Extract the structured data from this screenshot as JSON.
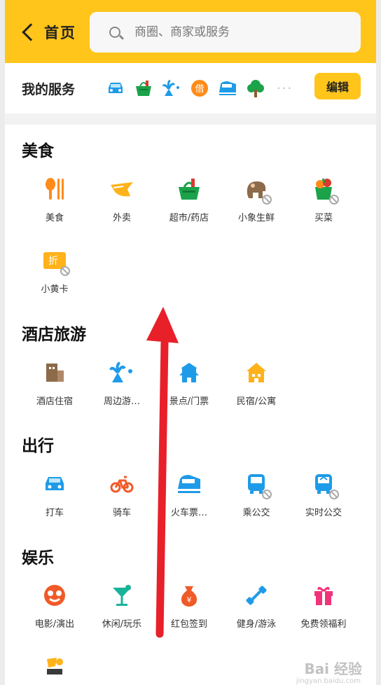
{
  "header": {
    "back_label": "首页",
    "search_placeholder": "商圈、商家或服务"
  },
  "my_services": {
    "title": "我的服务",
    "edit_label": "编辑",
    "more": "···"
  },
  "sections": [
    {
      "title": "美食",
      "items": [
        {
          "label": "美食"
        },
        {
          "label": "外卖"
        },
        {
          "label": "超市/药店"
        },
        {
          "label": "小象生鲜"
        },
        {
          "label": "买菜"
        },
        {
          "label": "小黄卡"
        }
      ]
    },
    {
      "title": "酒店旅游",
      "items": [
        {
          "label": "酒店住宿"
        },
        {
          "label": "周边游…"
        },
        {
          "label": "景点/门票"
        },
        {
          "label": "民宿/公寓"
        }
      ]
    },
    {
      "title": "出行",
      "items": [
        {
          "label": "打车"
        },
        {
          "label": "骑车"
        },
        {
          "label": "火车票…"
        },
        {
          "label": "乘公交"
        },
        {
          "label": "实时公交"
        }
      ]
    },
    {
      "title": "娱乐",
      "items": [
        {
          "label": "电影/演出"
        },
        {
          "label": "休闲/玩乐"
        },
        {
          "label": "红包签到"
        },
        {
          "label": "健身/游泳"
        },
        {
          "label": "免费领福利"
        }
      ]
    }
  ],
  "icons": {
    "quick": [
      "car-icon",
      "basket-icon",
      "beach-icon",
      "loan-icon",
      "train-icon",
      "tree-icon"
    ],
    "loan_glyph": "借",
    "discount_glyph": "折",
    "redpacket_glyph": "¥"
  },
  "watermark": {
    "text": "Bai 经验",
    "sub": "jingyan.baidu.com"
  },
  "colors": {
    "brand_yellow": "#ffc51b",
    "arrow_red": "#e8202a"
  }
}
